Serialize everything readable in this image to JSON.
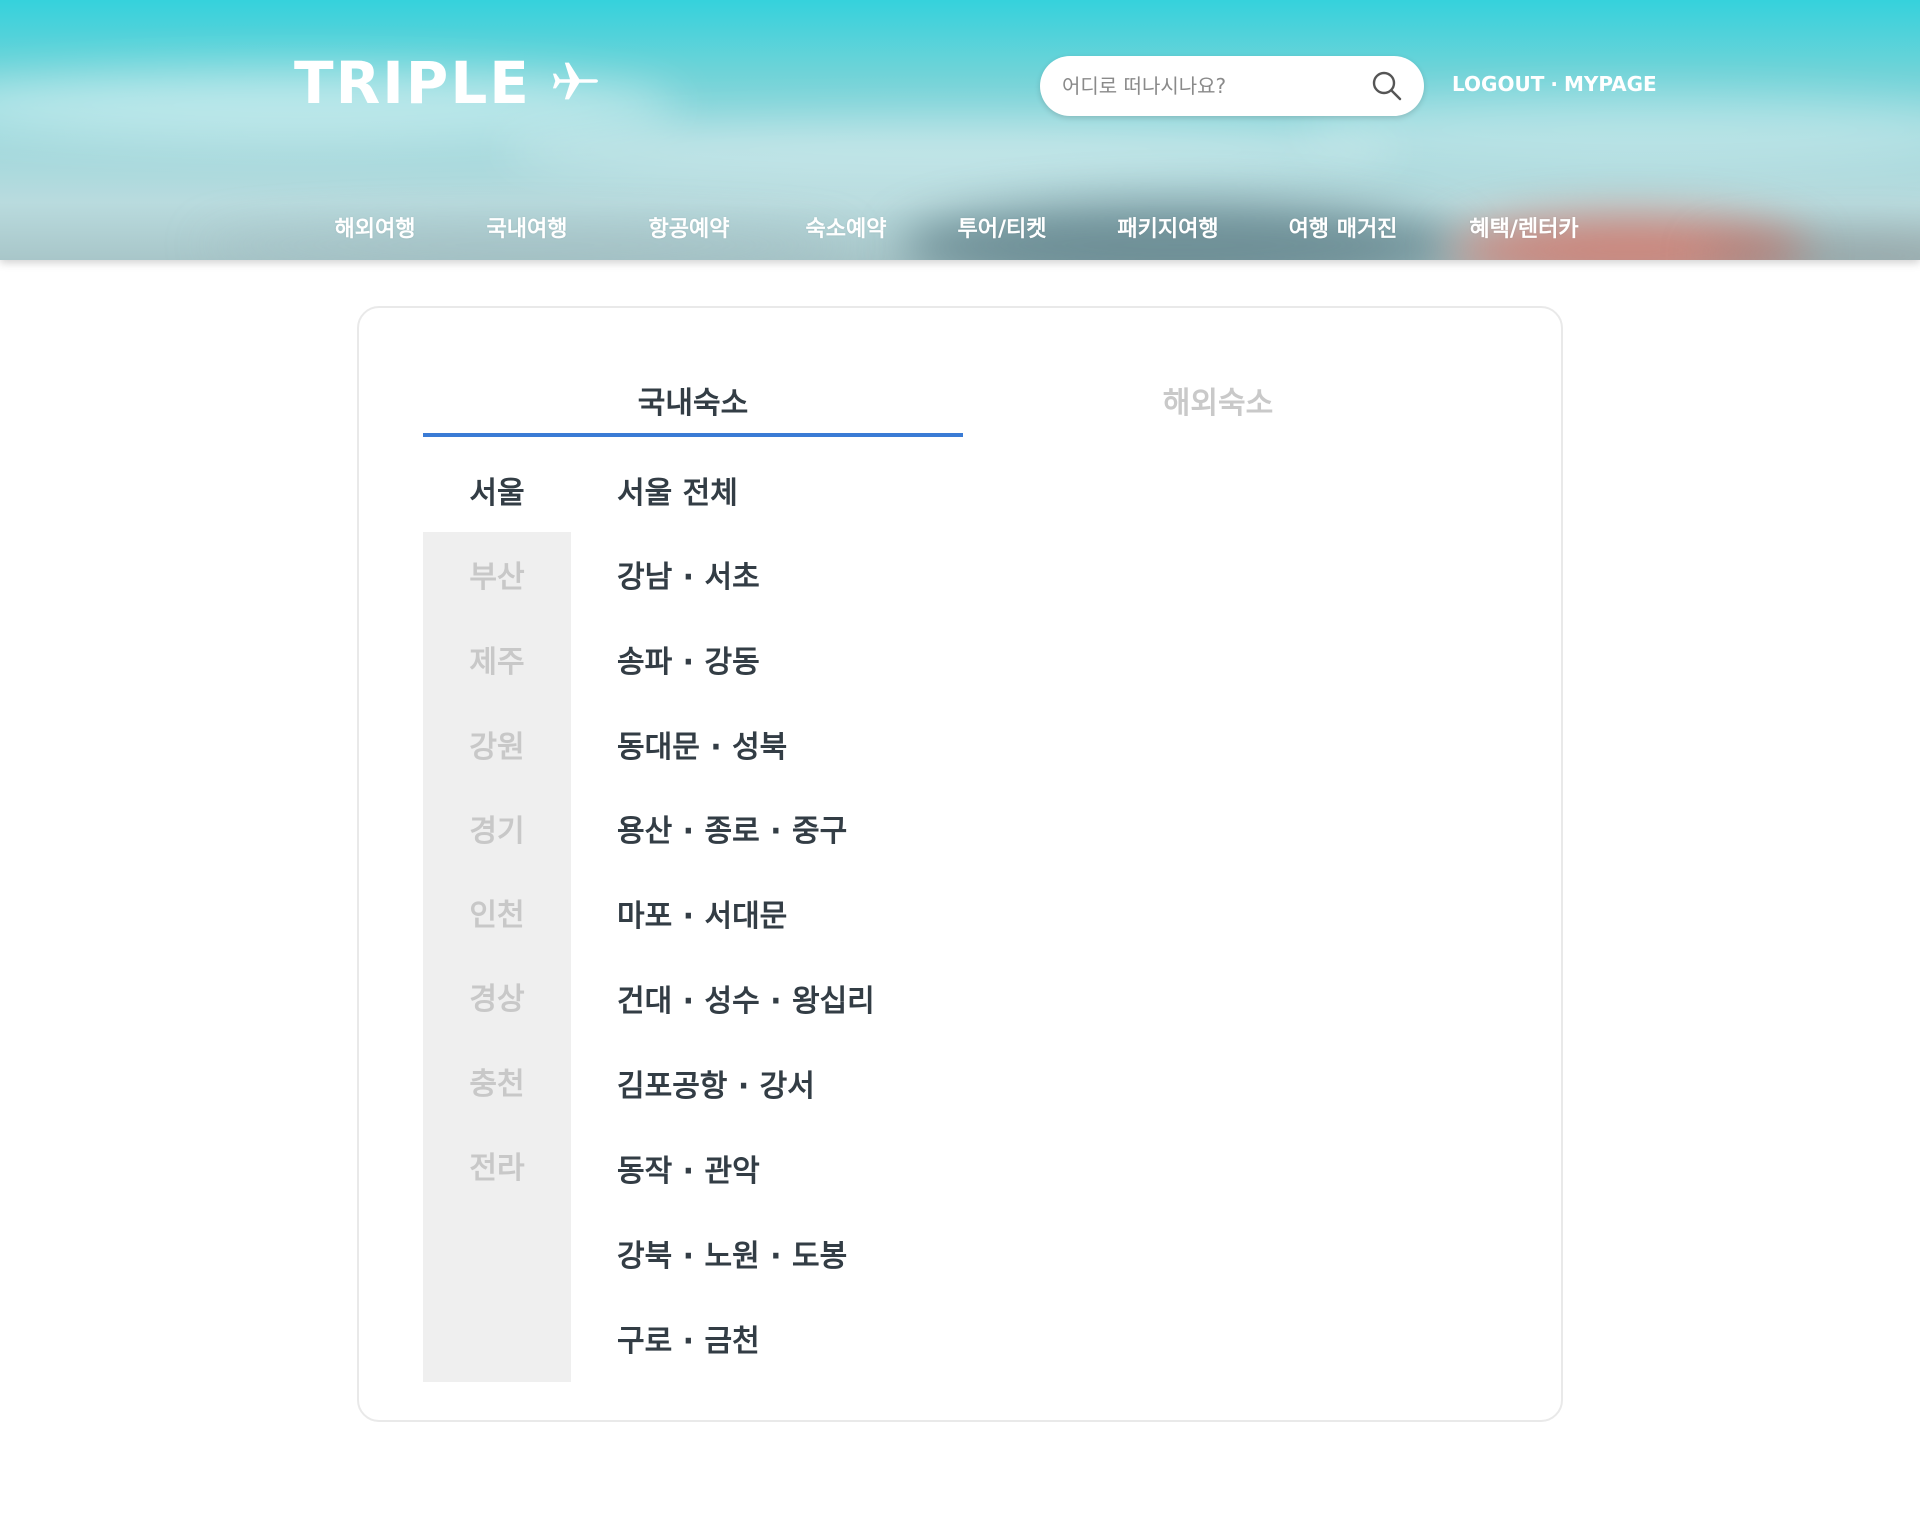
{
  "header": {
    "logo_text": "TRIPLE",
    "search": {
      "placeholder": "어디로 떠나시나요?"
    },
    "auth": {
      "logout": "LOGOUT",
      "separator": "·",
      "mypage": "MYPAGE"
    },
    "nav": [
      "해외여행",
      "국내여행",
      "항공예약",
      "숙소예약",
      "투어/티켓",
      "패키지여행",
      "여행 매거진",
      "혜택/렌터카"
    ]
  },
  "tabs": {
    "active": "국내숙소",
    "inactive": "해외숙소"
  },
  "regions": [
    "서울",
    "부산",
    "제주",
    "강원",
    "경기",
    "인천",
    "경상",
    "충천",
    "전라"
  ],
  "subareas": [
    "서울 전체",
    "강남 · 서초",
    "송파 · 강동",
    "동대문 · 성북",
    "용산 · 종로  · 중구",
    "마포 · 서대문",
    "건대 · 성수 · 왕십리",
    "김포공항 · 강서",
    "동작 · 관악",
    "강북 · 노원 · 도봉",
    "구로 · 금천"
  ],
  "colors": {
    "accent": "#3a7bd5",
    "text_dark": "#333d45",
    "text_muted": "#c8c8c8",
    "region_bg": "#efefef"
  }
}
